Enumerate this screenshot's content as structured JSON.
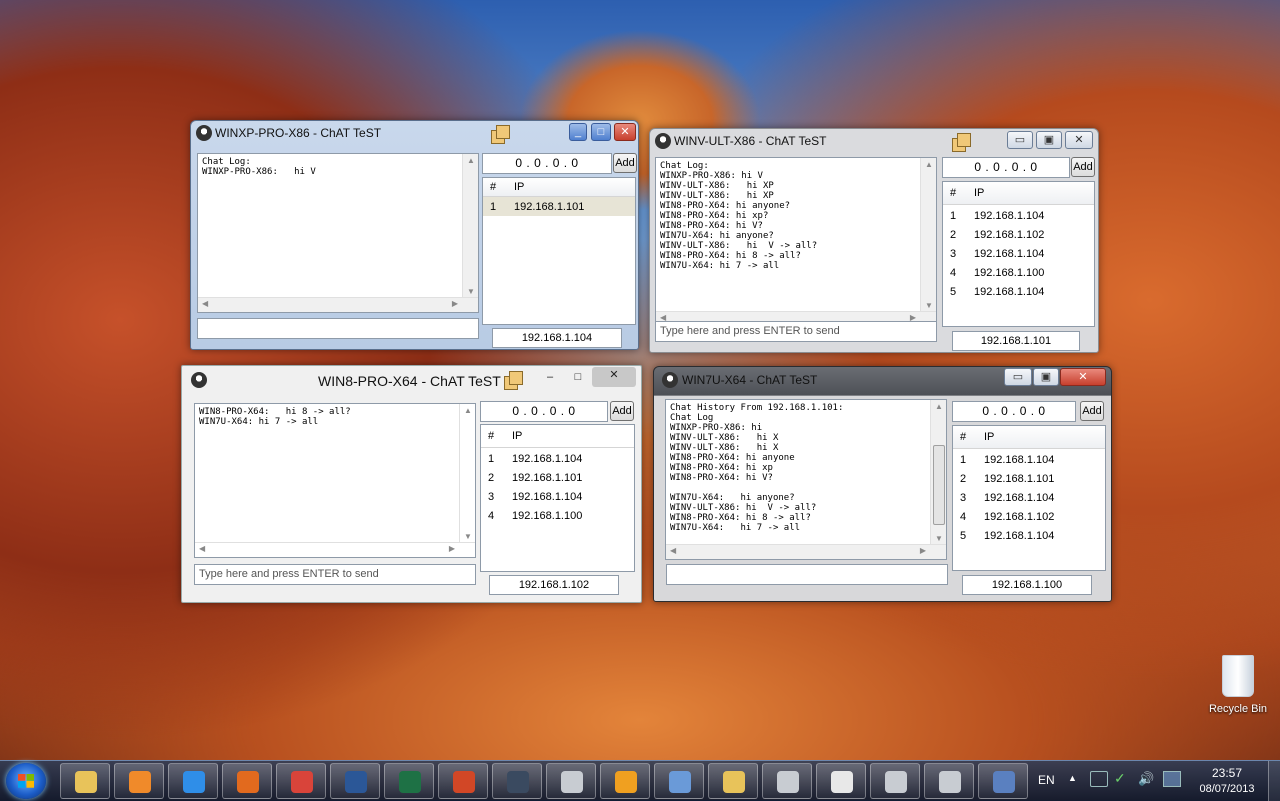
{
  "windows": {
    "w1": {
      "title": "WINXP-PRO-X86 - ChAT TeST",
      "log": "Chat Log:\nWINXP-PRO-X86:   hi V",
      "ip_input": "0 . 0 . 0 . 0",
      "add_label": "Add",
      "col_num": "#",
      "col_ip": "IP",
      "rows": [
        {
          "n": "1",
          "ip": "192.168.1.101"
        }
      ],
      "message_placeholder": "",
      "my_ip": "192.168.1.104"
    },
    "w2": {
      "title": "WINV-ULT-X86 - ChAT TeST",
      "log": "Chat Log:\nWINXP-PRO-X86: hi V\nWINV-ULT-X86:   hi XP\nWINV-ULT-X86:   hi XP\nWIN8-PRO-X64: hi anyone?\nWIN8-PRO-X64: hi xp?\nWIN8-PRO-X64: hi V?\nWIN7U-X64: hi anyone?\nWINV-ULT-X86:   hi  V -> all?\nWIN8-PRO-X64: hi 8 -> all?\nWIN7U-X64: hi 7 -> all",
      "ip_input": "0 . 0 . 0 . 0",
      "add_label": "Add",
      "col_num": "#",
      "col_ip": "IP",
      "rows": [
        {
          "n": "1",
          "ip": "192.168.1.104"
        },
        {
          "n": "2",
          "ip": "192.168.1.102"
        },
        {
          "n": "3",
          "ip": "192.168.1.104"
        },
        {
          "n": "4",
          "ip": "192.168.1.100"
        },
        {
          "n": "5",
          "ip": "192.168.1.104"
        }
      ],
      "message_placeholder": "Type here and press ENTER to send",
      "my_ip": "192.168.1.101"
    },
    "w3": {
      "title": "WIN8-PRO-X64 - ChAT TeST",
      "log": "WIN8-PRO-X64:   hi 8 -> all?\nWIN7U-X64: hi 7 -> all",
      "ip_input": "0 . 0 . 0 . 0",
      "add_label": "Add",
      "col_num": "#",
      "col_ip": "IP",
      "rows": [
        {
          "n": "1",
          "ip": "192.168.1.104"
        },
        {
          "n": "2",
          "ip": "192.168.1.101"
        },
        {
          "n": "3",
          "ip": "192.168.1.104"
        },
        {
          "n": "4",
          "ip": "192.168.1.100"
        }
      ],
      "message_placeholder": "Type here and press ENTER to send",
      "my_ip": "192.168.1.102"
    },
    "w4": {
      "title": "WIN7U-X64 - ChAT TeST",
      "log": "Chat History From 192.168.1.101:\nChat Log\nWINXP-PRO-X86: hi\nWINV-ULT-X86:   hi X\nWINV-ULT-X86:   hi X\nWIN8-PRO-X64: hi anyone\nWIN8-PRO-X64: hi xp\nWIN8-PRO-X64: hi V?\n\nWIN7U-X64:   hi anyone?\nWINV-ULT-X86: hi  V -> all?\nWIN8-PRO-X64: hi 8 -> all?\nWIN7U-X64:   hi 7 -> all",
      "ip_input": "0 . 0 . 0 . 0",
      "add_label": "Add",
      "col_num": "#",
      "col_ip": "IP",
      "rows": [
        {
          "n": "1",
          "ip": "192.168.1.104"
        },
        {
          "n": "2",
          "ip": "192.168.1.101"
        },
        {
          "n": "3",
          "ip": "192.168.1.104"
        },
        {
          "n": "4",
          "ip": "192.168.1.102"
        },
        {
          "n": "5",
          "ip": "192.168.1.104"
        }
      ],
      "message_placeholder": "",
      "my_ip": "192.168.1.100"
    }
  },
  "desktop": {
    "recycle_bin_label": "Recycle Bin"
  },
  "taskbar": {
    "pinned": [
      {
        "name": "explorer-icon",
        "color": "#e8c35a"
      },
      {
        "name": "media-player-icon",
        "color": "#f08a2a"
      },
      {
        "name": "internet-explorer-icon",
        "color": "#2f8ee8"
      },
      {
        "name": "firefox-icon",
        "color": "#e26a1e"
      },
      {
        "name": "chrome-icon",
        "color": "#d9443a"
      },
      {
        "name": "word-icon",
        "color": "#2b5797"
      },
      {
        "name": "excel-icon",
        "color": "#1e7145"
      },
      {
        "name": "powerpoint-icon",
        "color": "#d24726"
      },
      {
        "name": "remote-desktop-icon",
        "color": "#3a4a60"
      },
      {
        "name": "chat-app-icon",
        "color": "#c8ccd2"
      },
      {
        "name": "outlook-icon",
        "color": "#f0a020"
      },
      {
        "name": "network-icon",
        "color": "#6a9ad8"
      },
      {
        "name": "folder-icon",
        "color": "#e8c35a"
      },
      {
        "name": "chat-app-icon-2",
        "color": "#c8ccd2"
      },
      {
        "name": "document-icon",
        "color": "#e8e8e8"
      },
      {
        "name": "chat-app-icon-3",
        "color": "#c8ccd2"
      },
      {
        "name": "chat-app-icon-4",
        "color": "#c8ccd2"
      },
      {
        "name": "computer-icon",
        "color": "#5a80c0"
      }
    ],
    "language": "EN",
    "time": "23:57",
    "date": "08/07/2013"
  }
}
